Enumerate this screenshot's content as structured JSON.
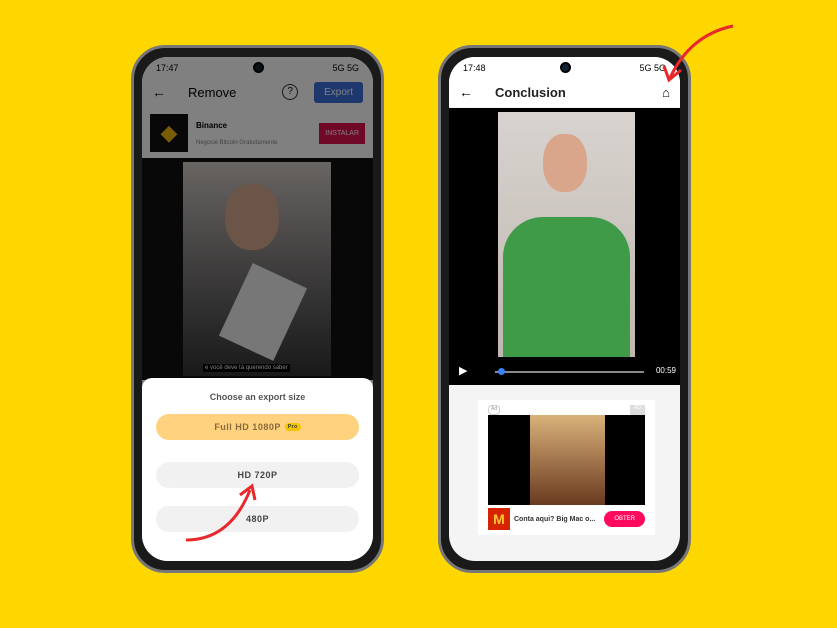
{
  "left": {
    "status": {
      "time": "17:47",
      "icons": "5G 5G"
    },
    "header": {
      "title": "Remove",
      "help": "?",
      "export_label": "Export"
    },
    "ad": {
      "title": "Binance",
      "subtitle": "Negocie Bitcoin Gratuitamente",
      "cta": "INSTALAR"
    },
    "video": {
      "caption": "e você deve tá querendo saber"
    },
    "sheet": {
      "title": "Choose an export size",
      "options": [
        {
          "label": "Full HD 1080P",
          "badge": "Pro"
        },
        {
          "label": "HD 720P"
        },
        {
          "label": "480P"
        }
      ]
    }
  },
  "right": {
    "status": {
      "time": "17:48",
      "icons": "5G 5G"
    },
    "header": {
      "title": "Conclusion"
    },
    "player": {
      "duration": "00:59",
      "progress": 0.02
    },
    "ad": {
      "badge": "Ad",
      "label": "AD",
      "text": "Conta aqui? Big Mac o...",
      "cta": "OBTER"
    }
  },
  "colors": {
    "background": "#FFD700",
    "export": "#3b6fd9",
    "pro": "#FFD27F",
    "cta": "#ff0a5c",
    "arrow": "#e8282b"
  }
}
